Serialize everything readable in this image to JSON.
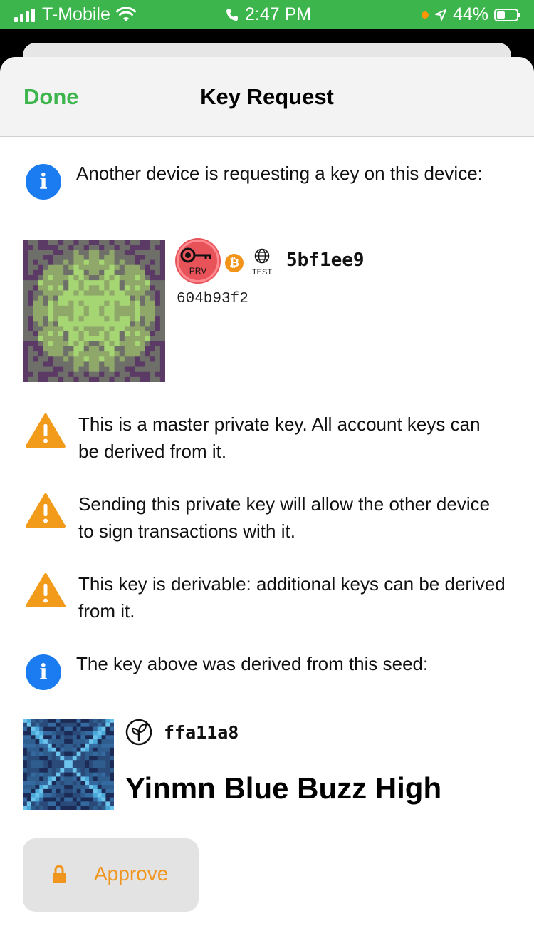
{
  "status_bar": {
    "carrier": "T-Mobile",
    "time": "2:47 PM",
    "battery": "44%",
    "battery_level": 0.44,
    "signal_bars": 4
  },
  "nav": {
    "done_label": "Done",
    "title": "Key Request"
  },
  "messages": {
    "request": "Another device is requesting a key on this device:",
    "warning_master": "This is a master private key. All account keys can be derived from it.",
    "warning_sign": "Sending this private key will allow the other device to sign transactions with it.",
    "warning_derivable": "This key is derivable: additional keys can be derived from it.",
    "derived_from": "The key above was derived from this seed:"
  },
  "key": {
    "type_badge": "PRV",
    "network_badge": "TEST",
    "fingerprint": "5bf1ee9",
    "sub_fingerprint": "604b93f2"
  },
  "seed": {
    "fingerprint": "ffa11a8",
    "name": "Yinmn Blue Buzz High"
  },
  "actions": {
    "approve_label": "Approve"
  },
  "colors": {
    "accent_green": "#3cb64c",
    "info_blue": "#1a7cf0",
    "warning_orange": "#f29a1a",
    "approve_orange": "#f0961e",
    "prv_red": "#e8535a",
    "btc_orange": "#f2931a"
  },
  "icons": {
    "info": "info-icon",
    "warning": "warning-icon",
    "seed": "seed-leaf-icon",
    "lock": "lock-icon",
    "bitcoin": "bitcoin-icon",
    "network": "globe-icon",
    "key": "key-icon"
  }
}
